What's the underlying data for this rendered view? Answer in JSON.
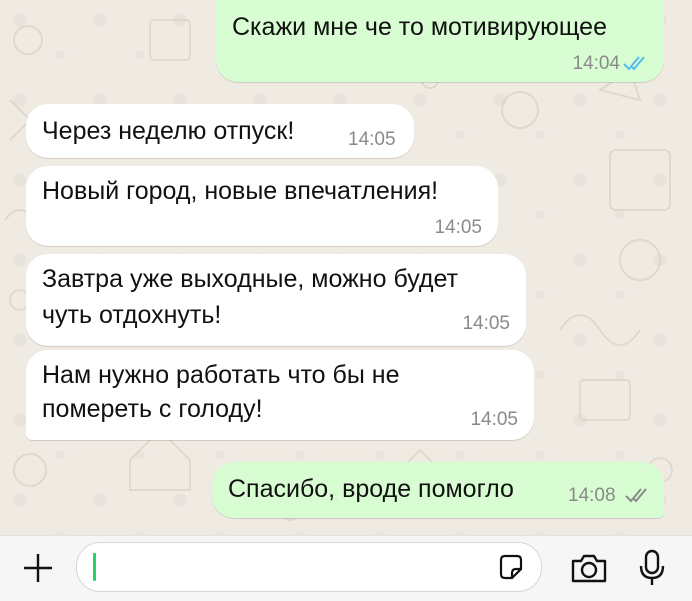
{
  "messages": [
    {
      "dir": "out",
      "text": "Скажи мне че то мотивирующее",
      "time": "14:04",
      "status": "read"
    },
    {
      "dir": "in",
      "text": "Через неделю отпуск!",
      "time": "14:05"
    },
    {
      "dir": "in",
      "text": "Новый город, новые впечатления!",
      "time": "14:05"
    },
    {
      "dir": "in",
      "lines": [
        "Завтра уже выходные, можно будет",
        "чуть отдохнуть!"
      ],
      "time": "14:05"
    },
    {
      "dir": "in",
      "lines": [
        "Нам нужно работать что бы не",
        "помереть с голоду!"
      ],
      "time": "14:05"
    },
    {
      "dir": "out",
      "text": "Спасибо, вроде помогло",
      "time": "14:08",
      "status": "delivered"
    }
  ],
  "composer": {
    "attach_icon": "plus-icon",
    "sticker_icon": "sticker-icon",
    "camera_icon": "camera-icon",
    "mic_icon": "microphone-icon",
    "input_value": ""
  },
  "colors": {
    "outgoing_bubble": "#d9fdd3",
    "incoming_bubble": "#ffffff",
    "wallpaper": "#efeae2",
    "read_ticks": "#53bdeb",
    "delivered_ticks": "#8a8a8a"
  }
}
